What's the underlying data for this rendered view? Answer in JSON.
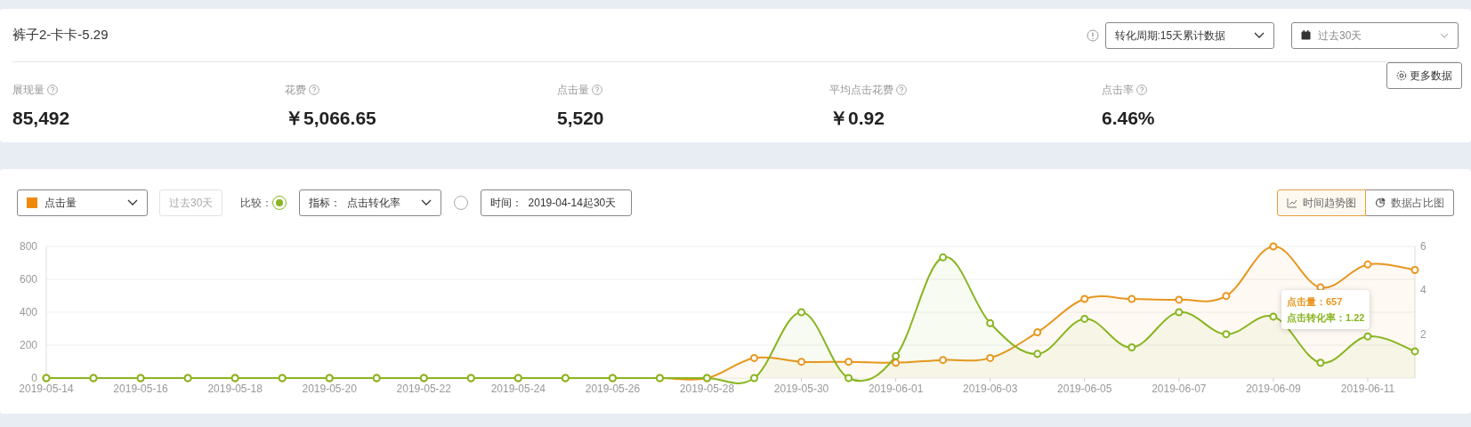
{
  "header": {
    "title": "裤子2-卡卡-5.29",
    "cycle_select": "转化周期:15天累计数据",
    "date_select": "过去30天",
    "more_button": "更多数据"
  },
  "metrics": [
    {
      "label": "展现量",
      "value": "85,492"
    },
    {
      "label": "花费",
      "value": "￥5,066.65"
    },
    {
      "label": "点击量",
      "value": "5,520"
    },
    {
      "label": "平均点击花费",
      "value": "￥0.92"
    },
    {
      "label": "点击率",
      "value": "6.46%"
    }
  ],
  "toolbar": {
    "metric_select": {
      "label": "点击量",
      "color": "#f08a0c"
    },
    "range_button": {
      "label": "过去30天",
      "disabled": true
    },
    "compare_label": "比较：",
    "compare_options": [
      {
        "kind": "metric",
        "label": "指标：  点击转化率",
        "selected": true
      },
      {
        "kind": "time",
        "label": "时间：  2019-04-14起30天",
        "selected": false
      }
    ],
    "view_tabs": [
      {
        "kind": "line",
        "label": "时间趋势图",
        "selected": true
      },
      {
        "kind": "pie",
        "label": "数据占比图",
        "selected": false
      }
    ]
  },
  "chart": {
    "chart_data": {
      "type": "line",
      "categories": [
        "2019-05-14",
        null,
        "2019-05-16",
        null,
        "2019-05-18",
        null,
        "2019-05-20",
        null,
        "2019-05-22",
        null,
        "2019-05-24",
        null,
        "2019-05-26",
        null,
        "2019-05-28",
        null,
        "2019-05-30",
        null,
        "2019-06-01",
        null,
        "2019-06-03",
        null,
        "2019-06-05",
        null,
        "2019-06-07",
        null,
        "2019-06-09",
        null,
        "2019-06-11",
        null
      ],
      "series": [
        {
          "color": "#e8961e",
          "marker": "circle",
          "values": [
            0,
            0,
            0,
            0,
            0,
            0,
            0,
            0,
            0,
            0,
            0,
            0,
            0,
            0,
            0,
            122,
            99,
            99,
            93,
            110,
            122,
            278,
            481,
            481,
            476,
            499,
            800,
            551,
            690,
            657
          ]
        },
        {
          "color": "#88b520",
          "marker": "circle",
          "axis": "y2",
          "values": [
            0,
            0,
            0,
            0,
            0,
            0,
            0,
            0,
            0,
            0,
            0,
            0,
            0,
            0,
            0,
            0,
            3.0,
            0,
            1.0,
            5.5,
            2.5,
            1.1,
            2.7,
            1.4,
            3.0,
            2.0,
            2.8,
            0.7,
            1.9,
            1.22
          ]
        }
      ],
      "grid": true,
      "ylim": [
        0,
        800
      ],
      "yticks": [
        0,
        200,
        400,
        600,
        800
      ],
      "y2lim": [
        0,
        6
      ],
      "y2ticks": [
        2,
        4,
        6
      ]
    },
    "tooltip": {
      "lines": [
        {
          "text": "点击量：657",
          "color": "#e8961e"
        },
        {
          "text": "点击转化率：1.22",
          "color": "#88b520"
        }
      ]
    }
  }
}
